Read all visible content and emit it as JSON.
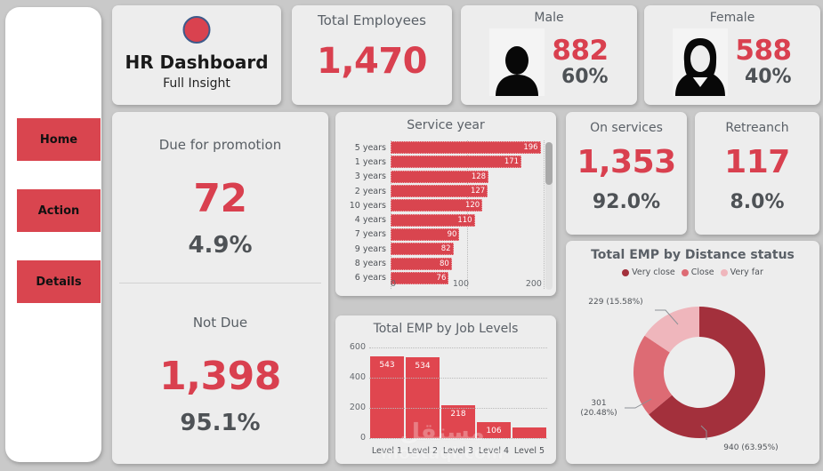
{
  "theme": {
    "accent_red": "#d9404f",
    "bar_red": "#e0464f",
    "donut_dark": "#a3303c",
    "donut_mid": "#dd6b74",
    "donut_light": "#efb6bc",
    "card_bg": "#ededed",
    "canvas_bg": "#c9c9c9"
  },
  "sidebar": {
    "items": [
      {
        "label": "Home"
      },
      {
        "label": "Action"
      },
      {
        "label": "Details"
      }
    ]
  },
  "header": {
    "title": "HR Dashboard",
    "subtitle": "Full Insight",
    "brand_icon": "circle-icon"
  },
  "kpis": {
    "total_employees": {
      "label": "Total Employees",
      "value": "1,470"
    },
    "male": {
      "label": "Male",
      "value": "882",
      "percent": "60%",
      "icon": "male-avatar-icon"
    },
    "female": {
      "label": "Female",
      "value": "588",
      "percent": "40%",
      "icon": "female-avatar-icon"
    },
    "on_services": {
      "label": "On services",
      "value": "1,353",
      "percent": "92.0%"
    },
    "retrench": {
      "label": "Retreanch",
      "value": "117",
      "percent": "8.0%"
    }
  },
  "promotion": {
    "due": {
      "label": "Due for promotion",
      "value": "72",
      "percent": "4.9%"
    },
    "not_due": {
      "label": "Not Due",
      "value": "1,398",
      "percent": "95.1%"
    }
  },
  "watermark": {
    "arabic": "مستقل",
    "latin": "mostaql.com"
  },
  "chart_data": [
    {
      "id": "service_year",
      "type": "bar",
      "orientation": "horizontal",
      "title": "Service year",
      "xlabel": "",
      "ylabel": "",
      "xlim": [
        0,
        200
      ],
      "xticks": [
        "0",
        "100",
        "200"
      ],
      "grid": true,
      "categories": [
        "5 years",
        "1 years",
        "3 years",
        "2 years",
        "10 years",
        "4 years",
        "7 years",
        "9 years",
        "8 years",
        "6 years"
      ],
      "values": [
        196,
        171,
        128,
        127,
        120,
        110,
        90,
        82,
        80,
        76
      ],
      "scrollable": true
    },
    {
      "id": "job_levels",
      "type": "bar",
      "orientation": "vertical",
      "title": "Total EMP by Job Levels",
      "xlabel": "",
      "ylabel": "",
      "ylim": [
        0,
        600
      ],
      "yticks": [
        "600",
        "400",
        "200",
        "0"
      ],
      "grid": true,
      "categories": [
        "Level 1",
        "Level 2",
        "Level 3",
        "Level 4",
        "Level 5"
      ],
      "values": [
        543,
        534,
        218,
        106,
        69
      ],
      "labels": [
        "543",
        "534",
        "218",
        "106",
        ""
      ]
    },
    {
      "id": "distance_status",
      "type": "pie",
      "variant": "donut",
      "title": "Total EMP by Distance status",
      "legend_position": "top",
      "labels": [
        "Very close",
        "Close",
        "Very far"
      ],
      "values": [
        940,
        301,
        229
      ],
      "percents": [
        "63.95%",
        "20.48%",
        "15.58%"
      ],
      "colors": [
        "#a3303c",
        "#dd6b74",
        "#efb6bc"
      ],
      "annotations": [
        "940 (63.95%)",
        "301\n(20.48%)",
        "229 (15.58%)"
      ],
      "annotation_very_close": "940 (63.95%)",
      "annotation_close_line1": "301",
      "annotation_close_line2": "(20.48%)",
      "annotation_very_far": "229 (15.58%)"
    }
  ]
}
